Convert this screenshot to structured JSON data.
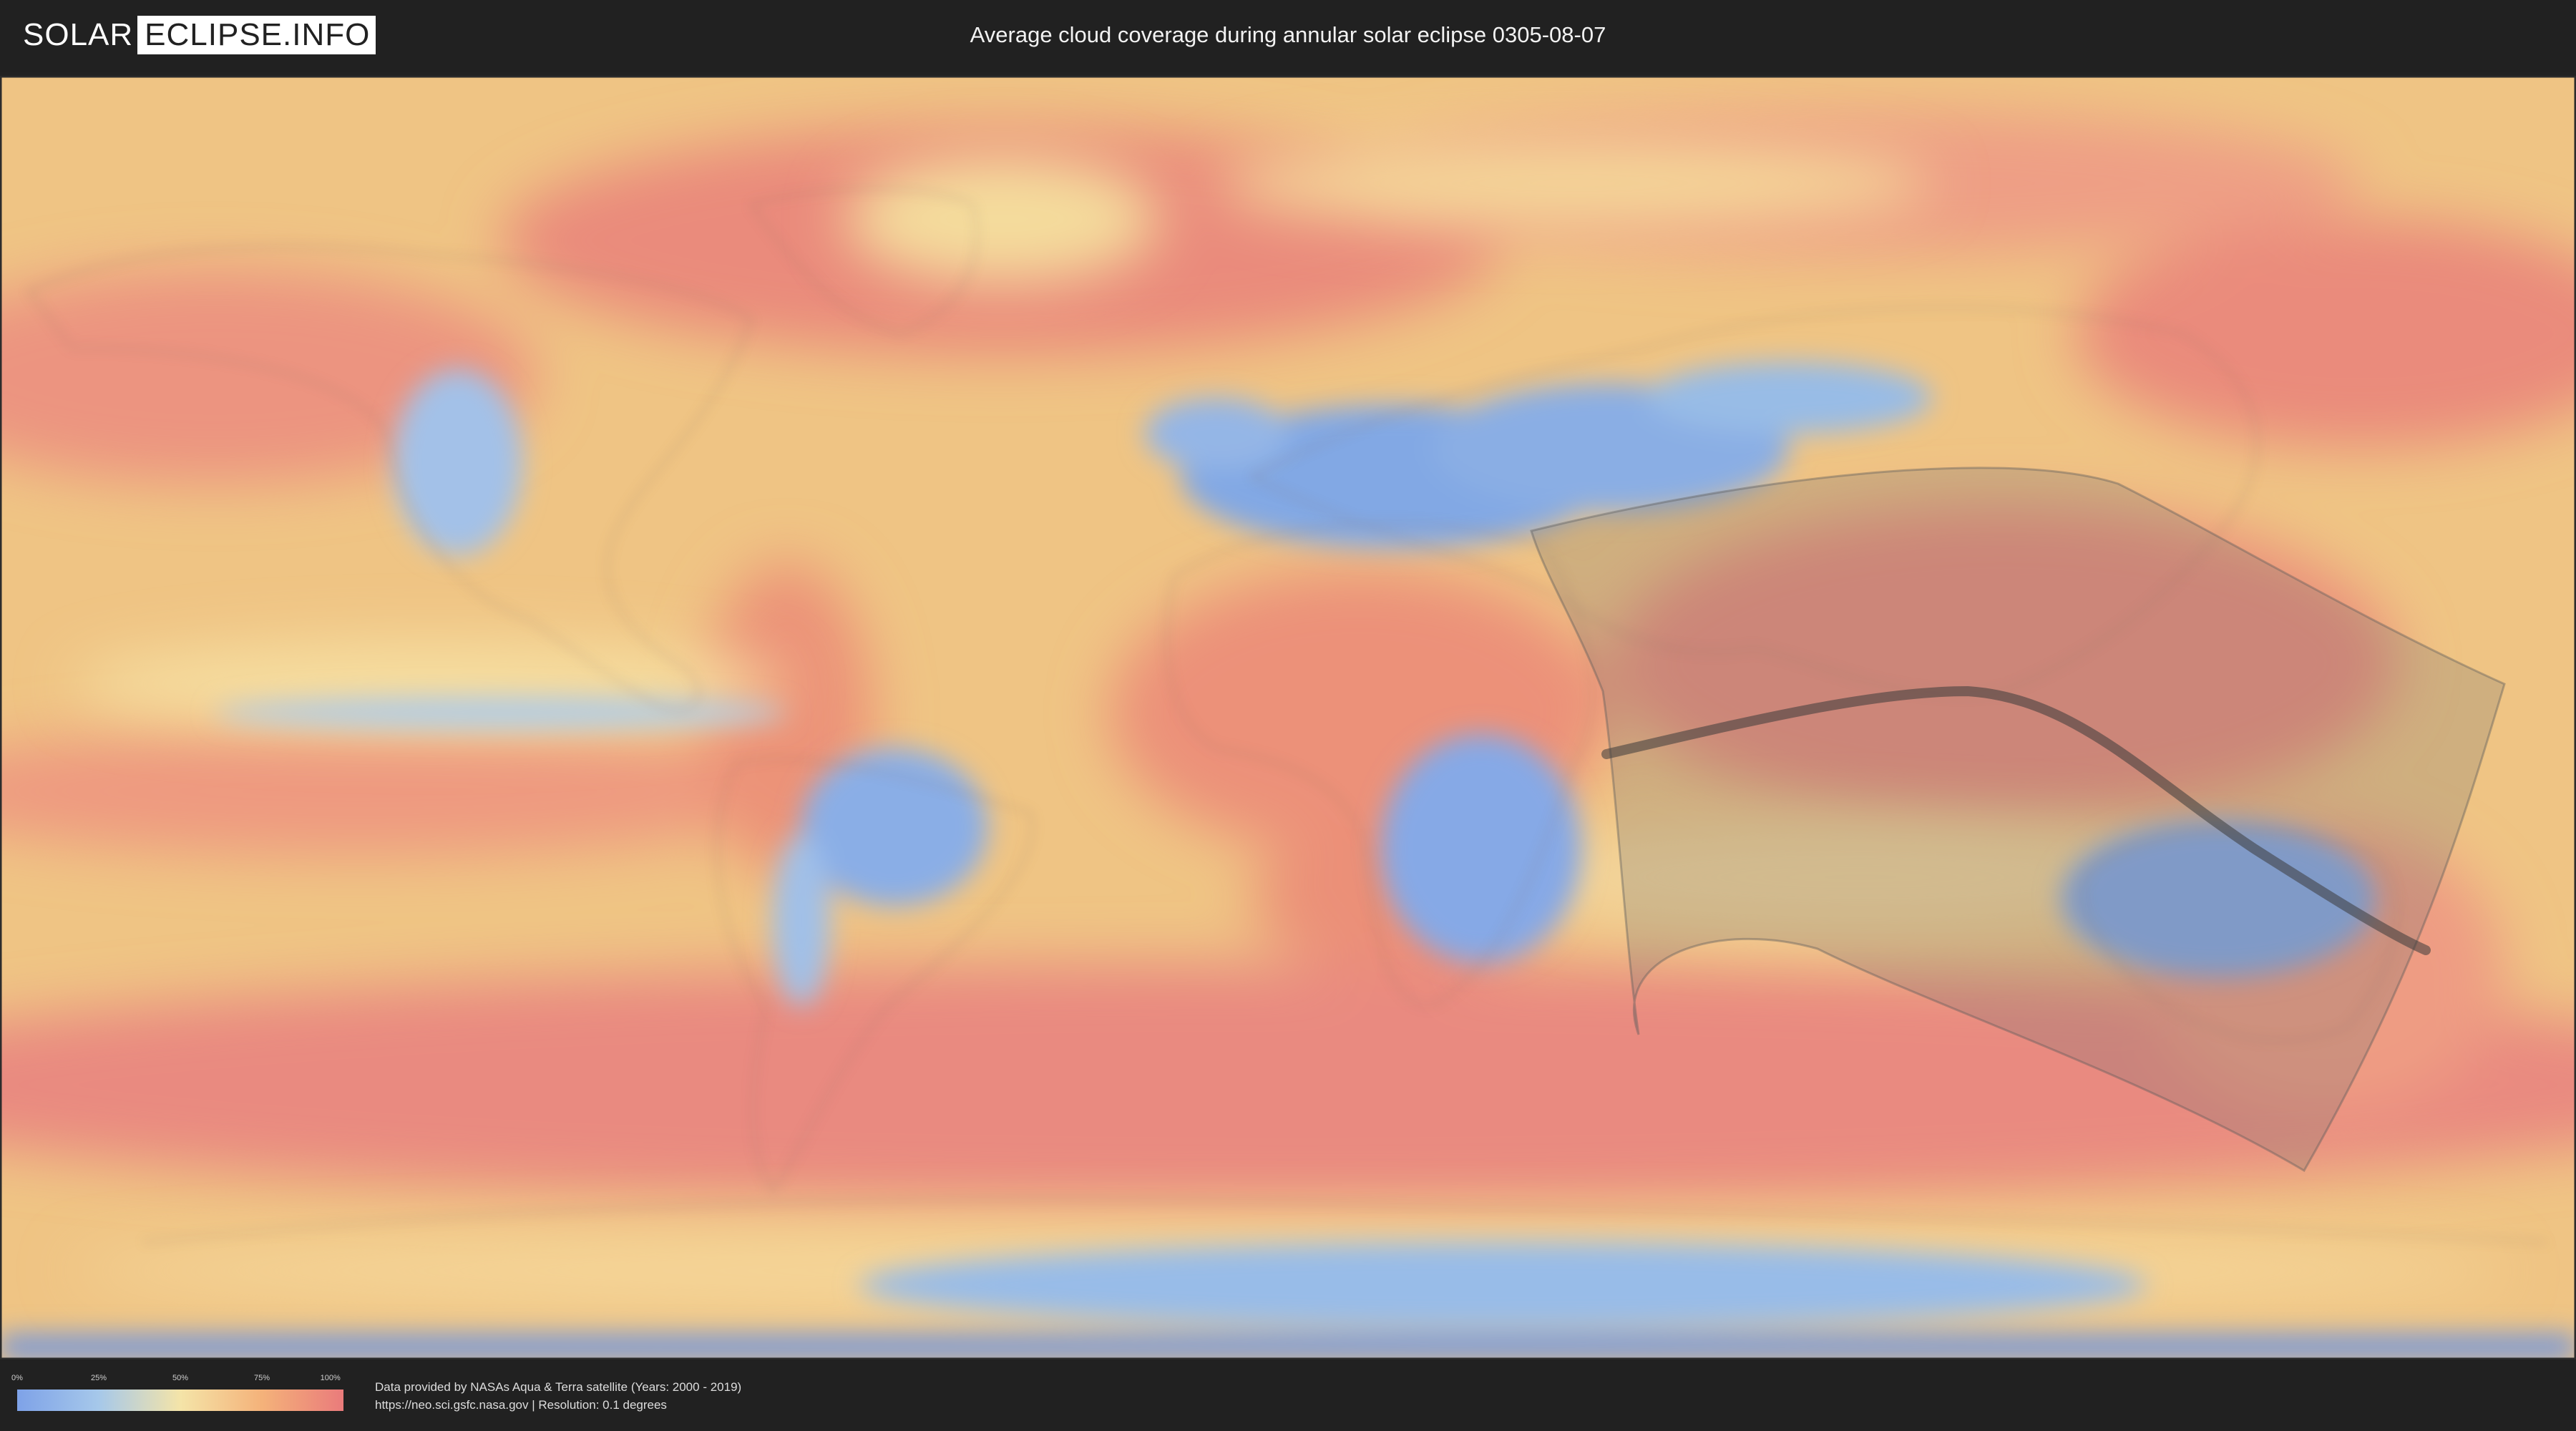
{
  "header": {
    "logo": {
      "part1": "SOLAR",
      "part2": "ECLIPSE.INFO"
    },
    "title": "Average cloud coverage during annular solar eclipse 0305-08-07"
  },
  "map": {
    "description_layers": [
      "cloud-coverage-raster",
      "country-borders",
      "eclipse-visibility-zone",
      "annular-central-line"
    ],
    "colors": {
      "clear": "#7ea2e8",
      "low": "#a6c8ea",
      "mid": "#f4e4a8",
      "high": "#f4b27a",
      "overcast": "#ea7b7b",
      "eclipse_zone": "#6e6e6e",
      "central_line": "#3a3a3a"
    }
  },
  "legend": {
    "ticks": [
      "0%",
      "25%",
      "50%",
      "75%",
      "100%"
    ],
    "tick_values": [
      0,
      25,
      50,
      75,
      100
    ]
  },
  "credits": {
    "line1": "Data provided by NASAs Aqua & Terra satellite (Years: 2000 - 2019)",
    "line2": "https://neo.sci.gsfc.nasa.gov | Resolution: 0.1 degrees"
  }
}
